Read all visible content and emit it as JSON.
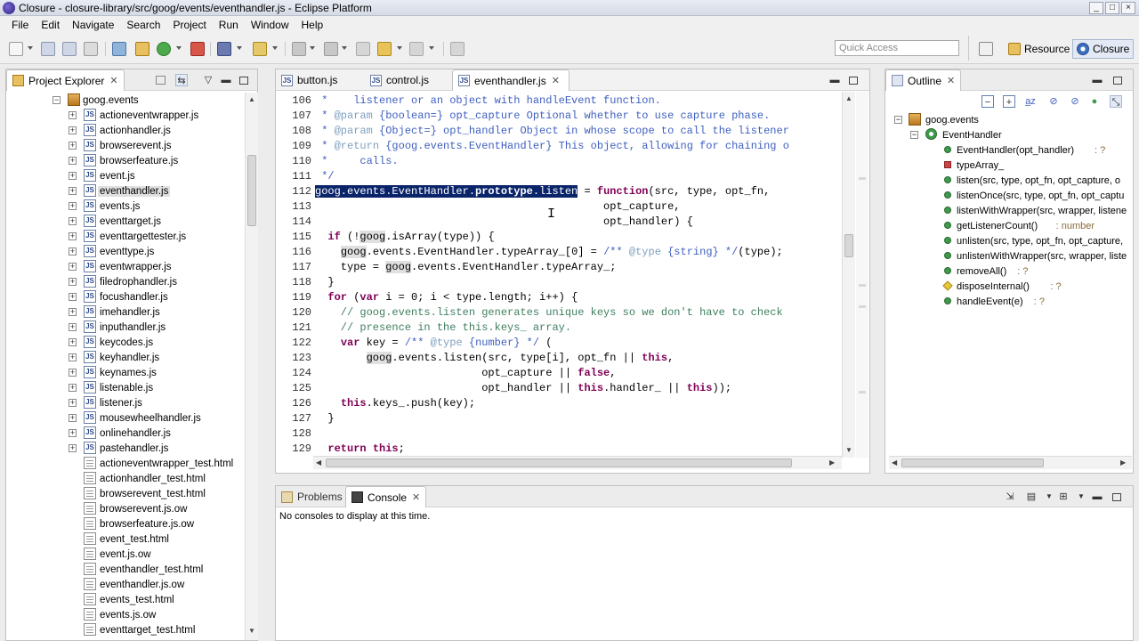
{
  "window": {
    "title": "Closure - closure-library/src/goog/events/eventhandler.js - Eclipse Platform",
    "minimize": "_",
    "maximize": "□",
    "close": "×"
  },
  "menu": [
    "File",
    "Edit",
    "Navigate",
    "Search",
    "Project",
    "Run",
    "Window",
    "Help"
  ],
  "toolbar": {
    "quick_access_placeholder": "Quick Access",
    "perspectives": [
      {
        "label": "Resource",
        "active": false
      },
      {
        "label": "Closure",
        "active": true
      }
    ]
  },
  "project_explorer": {
    "title": "Project Explorer",
    "package": "goog.events",
    "items": [
      {
        "name": "actioneventwrapper.js",
        "kind": "js"
      },
      {
        "name": "actionhandler.js",
        "kind": "js"
      },
      {
        "name": "browserevent.js",
        "kind": "js"
      },
      {
        "name": "browserfeature.js",
        "kind": "js"
      },
      {
        "name": "event.js",
        "kind": "js"
      },
      {
        "name": "eventhandler.js",
        "kind": "js",
        "selected": true
      },
      {
        "name": "events.js",
        "kind": "js"
      },
      {
        "name": "eventtarget.js",
        "kind": "js"
      },
      {
        "name": "eventtargettester.js",
        "kind": "js"
      },
      {
        "name": "eventtype.js",
        "kind": "js"
      },
      {
        "name": "eventwrapper.js",
        "kind": "js"
      },
      {
        "name": "filedrophandler.js",
        "kind": "js"
      },
      {
        "name": "focushandler.js",
        "kind": "js"
      },
      {
        "name": "imehandler.js",
        "kind": "js"
      },
      {
        "name": "inputhandler.js",
        "kind": "js"
      },
      {
        "name": "keycodes.js",
        "kind": "js"
      },
      {
        "name": "keyhandler.js",
        "kind": "js"
      },
      {
        "name": "keynames.js",
        "kind": "js"
      },
      {
        "name": "listenable.js",
        "kind": "js"
      },
      {
        "name": "listener.js",
        "kind": "js"
      },
      {
        "name": "mousewheelhandler.js",
        "kind": "js"
      },
      {
        "name": "onlinehandler.js",
        "kind": "js"
      },
      {
        "name": "pastehandler.js",
        "kind": "js"
      },
      {
        "name": "actioneventwrapper_test.html",
        "kind": "html"
      },
      {
        "name": "actionhandler_test.html",
        "kind": "html"
      },
      {
        "name": "browserevent_test.html",
        "kind": "html"
      },
      {
        "name": "browserevent.js.ow",
        "kind": "html"
      },
      {
        "name": "browserfeature.js.ow",
        "kind": "html"
      },
      {
        "name": "event_test.html",
        "kind": "html"
      },
      {
        "name": "event.js.ow",
        "kind": "html"
      },
      {
        "name": "eventhandler_test.html",
        "kind": "html"
      },
      {
        "name": "eventhandler.js.ow",
        "kind": "html"
      },
      {
        "name": "events_test.html",
        "kind": "html"
      },
      {
        "name": "events.js.ow",
        "kind": "html"
      },
      {
        "name": "eventtarget_test.html",
        "kind": "html"
      }
    ]
  },
  "editor": {
    "tabs": [
      {
        "label": "button.js",
        "active": false
      },
      {
        "label": "control.js",
        "active": false
      },
      {
        "label": "eventhandler.js",
        "active": true
      }
    ]
  },
  "outline": {
    "title": "Outline",
    "root": "goog.events",
    "class": "EventHandler",
    "members": [
      {
        "name": "EventHandler(opt_handler)",
        "type": " : ?",
        "icon": "constructor"
      },
      {
        "name": "typeArray_",
        "type": "",
        "icon": "static"
      },
      {
        "name": "listen(src, type, opt_fn, opt_capture, o",
        "type": "",
        "icon": "public"
      },
      {
        "name": "listenOnce(src, type, opt_fn, opt_captu",
        "type": "",
        "icon": "public"
      },
      {
        "name": "listenWithWrapper(src, wrapper, listene",
        "type": "",
        "icon": "public"
      },
      {
        "name": "getListenerCount()",
        "type": " : number",
        "icon": "public"
      },
      {
        "name": "unlisten(src, type, opt_fn, opt_capture,",
        "type": "",
        "icon": "public"
      },
      {
        "name": "unlistenWithWrapper(src, wrapper, liste",
        "type": "",
        "icon": "public"
      },
      {
        "name": "removeAll()",
        "type": " : ?",
        "icon": "public"
      },
      {
        "name": "disposeInternal()",
        "type": " : ?",
        "icon": "protected"
      },
      {
        "name": "handleEvent(e)",
        "type": " : ?",
        "icon": "public"
      }
    ]
  },
  "bottom_panel": {
    "tabs": [
      {
        "label": "Problems",
        "active": false
      },
      {
        "label": "Console",
        "active": true
      }
    ],
    "message": "No consoles to display at this time."
  },
  "colors": {
    "selection": "#0a246a",
    "keyword": "#7f0055",
    "comment": "#3f7f5f",
    "javadoc": "#3f5fbf"
  }
}
